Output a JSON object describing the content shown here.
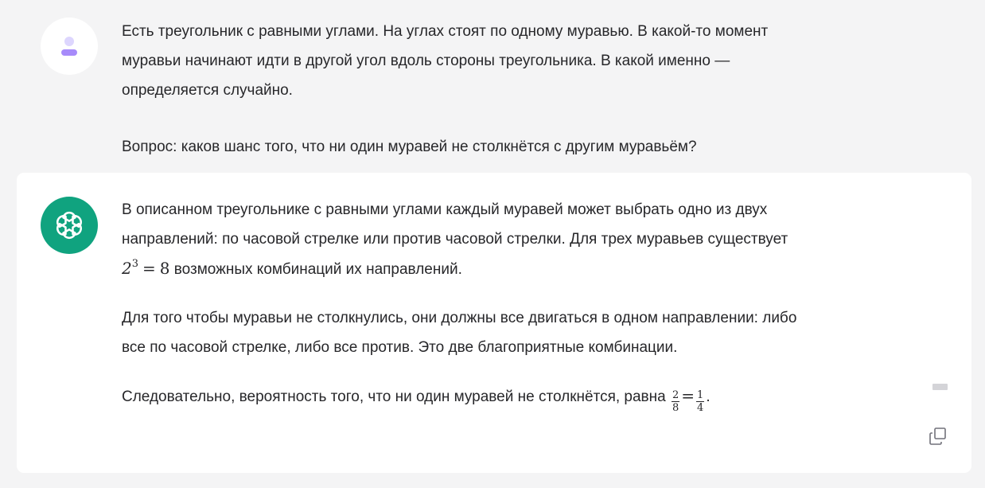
{
  "conversation": {
    "user_message": {
      "paragraph_1_line_1": "Есть треугольник с равными углами. На углах стоят по одному муравью. В какой-то момент",
      "paragraph_1_line_2": "муравьи начинают идти в другой угол вдоль стороны треугольника. В какой именно —",
      "paragraph_1_line_3": "определяется случайно.",
      "paragraph_2": "Вопрос: каков шанс того, что ни один муравей не столкнётся с другим муравьём?"
    },
    "assistant_message": {
      "paragraph_1_line_1": "В описанном треугольнике с равными углами каждый муравей может выбрать одно из двух",
      "paragraph_1_line_2": "направлений: по часовой стрелке или против часовой стрелки. Для трех муравьев существует",
      "formula_base": "2",
      "formula_exp": "3",
      "formula_eq": "=",
      "formula_result": "8",
      "paragraph_1_line_3_rest": " возможных комбинаций их направлений.",
      "paragraph_2_line_1": "Для того чтобы муравьи не столкнулись, они должны все двигаться в одном направлении: либо",
      "paragraph_2_line_2": "все по часовой стрелке, либо все против. Это две благоприятные комбинации.",
      "paragraph_3_text": "Следовательно, вероятность того, что ни один муравей не столкнётся, равна ",
      "frac1_num": "2",
      "frac1_den": "8",
      "eq": "=",
      "frac2_num": "1",
      "frac2_den": "4",
      "period": "."
    }
  },
  "icons": {
    "user_avatar": "user-avatar-icon",
    "assistant_logo": "openai-logo-icon",
    "copy": "copy-icon"
  },
  "colors": {
    "background": "#f4f4f5",
    "card": "#ffffff",
    "brand_green": "#10a37f",
    "avatar_purple": "#a78bfa"
  }
}
